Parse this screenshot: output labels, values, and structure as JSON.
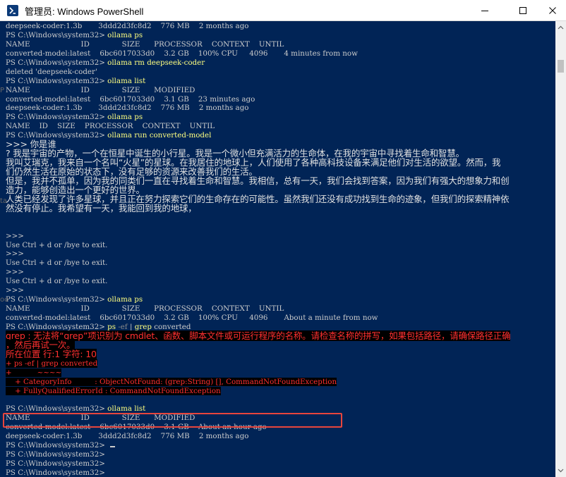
{
  "window": {
    "title": "管理员: Windows PowerShell"
  },
  "icons": {
    "app": "powershell-icon",
    "minimize": "minimize-icon",
    "maximize": "maximize-icon",
    "close": "close-icon"
  },
  "colors": {
    "terminal_bg": "#012456",
    "text": "#cccccc",
    "command": "#ffff80",
    "error": "#ff3030",
    "highlight_box": "#e8453c"
  },
  "terminal": {
    "lines": [
      {
        "segments": [
          {
            "text": "deepseek-coder:1.3b       3ddd2d3fc8d2    776 MB    2 months ago"
          }
        ]
      },
      {
        "segments": [
          {
            "text": "PS C:\\Windows\\system32> "
          },
          {
            "text": "ollama ps",
            "cls": "cmd"
          }
        ]
      },
      {
        "segments": [
          {
            "text": "NAME                      ID              SIZE      PROCESSOR    CONTEXT    UNTIL"
          }
        ]
      },
      {
        "segments": [
          {
            "text": "converted-model:latest    6bc6017033d0    3.2 GB    100% CPU     4096       4 minutes from now"
          }
        ]
      },
      {
        "segments": [
          {
            "text": "PS C:\\Windows\\system32> "
          },
          {
            "text": "ollama rm deepseek-coder",
            "cls": "cmd"
          }
        ]
      },
      {
        "segments": [
          {
            "text": "deleted 'deepseek-coder'"
          }
        ]
      },
      {
        "segments": [
          {
            "text": "PS C:\\Windows\\system32> "
          },
          {
            "text": "ollama list",
            "cls": "cmd"
          }
        ]
      },
      {
        "segments": [
          {
            "text": "NAME                      ID              SIZE      MODIFIED"
          }
        ]
      },
      {
        "segments": [
          {
            "text": "converted-model:latest    6bc6017033d0    3.1 GB    23 minutes ago"
          }
        ]
      },
      {
        "segments": [
          {
            "text": "deepseek-coder:1.3b       3ddd2d3fc8d2    776 MB    2 months ago"
          }
        ]
      },
      {
        "segments": [
          {
            "text": "PS C:\\Windows\\system32> "
          },
          {
            "text": "ollama ps",
            "cls": "cmd"
          }
        ]
      },
      {
        "segments": [
          {
            "text": "NAME    ID    SIZE    PROCESSOR    CONTEXT    UNTIL"
          }
        ]
      },
      {
        "segments": [
          {
            "text": "PS C:\\Windows\\system32> "
          },
          {
            "text": "ollama run converted-model",
            "cls": "cmd"
          }
        ]
      },
      {
        "cls": "wide",
        "segments": [
          {
            "text": ">>> 你是谁"
          }
        ]
      },
      {
        "cls": "wide",
        "segments": [
          {
            "text": "? 我是宇宙的产物，一个在恒星中诞生的小行星。我是一个微小但充满活力的生命体，在我的宇宙中寻找着生命和智慧。"
          }
        ]
      },
      {
        "cls": "wide",
        "segments": [
          {
            "text": "我叫艾瑞克，我来自一个名叫“火星”的星球。在我居住的地球上，人们使用了各种高科技设备来满足他们对生活的欲望。然而，我"
          }
        ]
      },
      {
        "cls": "wide",
        "segments": [
          {
            "text": "们仍然生活在原始的状态下，没有足够的资源来改善我们的生活。"
          }
        ]
      },
      {
        "cls": "wide",
        "segments": [
          {
            "text": "但是，我并不孤单，因为我的同类们一直在寻找着生命和智慧。我相信，总有一天，我们会找到答案，因为我们有强大的想象力和创"
          }
        ]
      },
      {
        "cls": "wide",
        "segments": [
          {
            "text": "造力，能够创造出一个更好的世界。"
          }
        ]
      },
      {
        "cls": "wide",
        "segments": [
          {
            "text": "人类已经发现了许多星球，并且正在努力探索它们的生命存在的可能性。虽然我们还没有成功找到生命的迹象，但我们的探索精神依"
          }
        ]
      },
      {
        "cls": "wide",
        "segments": [
          {
            "text": "然没有停止。我希望有一天，我能回到我的地球，"
          }
        ]
      },
      {
        "segments": [
          {
            "text": ""
          }
        ]
      },
      {
        "segments": [
          {
            "text": ""
          }
        ]
      },
      {
        "segments": [
          {
            "text": ">>>"
          }
        ]
      },
      {
        "segments": [
          {
            "text": "Use Ctrl + d or /bye to exit."
          }
        ]
      },
      {
        "segments": [
          {
            "text": ">>>"
          }
        ]
      },
      {
        "segments": [
          {
            "text": "Use Ctrl + d or /bye to exit."
          }
        ]
      },
      {
        "segments": [
          {
            "text": ">>>"
          }
        ]
      },
      {
        "segments": [
          {
            "text": "Use Ctrl + d or /bye to exit."
          }
        ]
      },
      {
        "segments": [
          {
            "text": ">>>"
          }
        ]
      },
      {
        "segments": [
          {
            "text": "PS C:\\Windows\\system32> "
          },
          {
            "text": "ollama ps",
            "cls": "cmd"
          }
        ]
      },
      {
        "segments": [
          {
            "text": "NAME                      ID              SIZE      PROCESSOR    CONTEXT    UNTIL"
          }
        ]
      },
      {
        "segments": [
          {
            "text": "converted-model:latest    6bc6017033d0    3.2 GB    100% CPU     4096       About a minute from now"
          }
        ]
      },
      {
        "segments": [
          {
            "text": "PS C:\\Windows\\system32> "
          },
          {
            "text": "ps",
            "cls": "cmd"
          },
          {
            "text": " -ef ",
            "cls": "arg"
          },
          {
            "text": "| "
          },
          {
            "text": "grep",
            "cls": "cmd"
          },
          {
            "text": " converted"
          }
        ]
      },
      {
        "cls": "err wide",
        "segments": [
          {
            "text": "grep : 无法将“grep”项识别为 cmdlet、函数、脚本文件或可运行程序的名称。请检查名称的拼写，如果包括路径，请确保路径正确",
            "cls": "errbg"
          }
        ]
      },
      {
        "cls": "err wide",
        "segments": [
          {
            "text": "，然后再试一次。",
            "cls": "errbg"
          }
        ]
      },
      {
        "cls": "err wide",
        "segments": [
          {
            "text": "所在位置 行:1 字符: 10",
            "cls": "errbg"
          }
        ]
      },
      {
        "cls": "err",
        "segments": [
          {
            "text": "+ ps -ef | grep converted",
            "cls": "errbg"
          }
        ]
      },
      {
        "cls": "err",
        "segments": [
          {
            "text": "+           ~~~~",
            "cls": "errbg"
          }
        ]
      },
      {
        "cls": "err",
        "segments": [
          {
            "text": "    + CategoryInfo          : ObjectNotFound: (grep:String) [], CommandNotFoundException",
            "cls": "errbg"
          }
        ]
      },
      {
        "cls": "err",
        "segments": [
          {
            "text": "    + FullyQualifiedErrorId : CommandNotFoundException",
            "cls": "errbg"
          }
        ]
      },
      {
        "segments": [
          {
            "text": ""
          }
        ]
      },
      {
        "segments": [
          {
            "text": "PS C:\\Windows\\system32> "
          },
          {
            "text": "ollama list",
            "cls": "cmd"
          }
        ]
      },
      {
        "segments": [
          {
            "text": "NAME                      ID              SIZE      MODIFIED"
          }
        ]
      },
      {
        "segments": [
          {
            "text": "converted-model:latest    6bc6017033d0    3.1 GB    About an hour ago"
          }
        ]
      },
      {
        "segments": [
          {
            "text": "deepseek-coder:1.3b       3ddd2d3fc8d2    776 MB    2 months ago"
          }
        ]
      },
      {
        "segments": [
          {
            "text": "PS C:\\Windows\\system32> "
          }
        ],
        "cursor": true
      },
      {
        "segments": [
          {
            "text": "PS C:\\Windows\\system32>"
          }
        ]
      },
      {
        "segments": [
          {
            "text": "PS C:\\Windows\\system32>"
          }
        ]
      },
      {
        "segments": [
          {
            "text": "PS C:\\Windows\\system32>"
          }
        ]
      },
      {
        "segments": [
          {
            "text": "PS C:\\Windows\\system32>"
          }
        ]
      }
    ]
  },
  "left_edge_fragments": [
    "P",
    "ta",
    "oo"
  ]
}
